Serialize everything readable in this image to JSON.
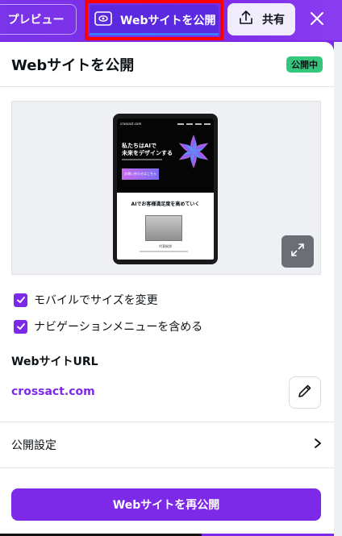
{
  "toolbar": {
    "preview_label": "プレビュー",
    "publish_label": "Webサイトを公開",
    "share_label": "共有"
  },
  "panel": {
    "title": "Webサイトを公開",
    "status_badge": "公開中"
  },
  "preview_site": {
    "logo": "crossact.com",
    "hero_title_line1": "私たちはAIで",
    "hero_title_line2": "未来をデザインする",
    "cta_label": "お問い合わせはこちら",
    "section_title": "AIでお客様満足度を高めていく",
    "person_caption": "代表挨拶"
  },
  "options": [
    {
      "label": "モバイルでサイズを変更",
      "checked": true
    },
    {
      "label": "ナビゲーションメニューを含める",
      "checked": true
    }
  ],
  "website_url": {
    "label": "WebサイトURL",
    "value": "crossact.com"
  },
  "settings": {
    "label": "公開設定"
  },
  "republish_label": "Webサイトを再公開",
  "colors": {
    "accent": "#7d2ae8",
    "status_green": "#34c77b",
    "highlight_red": "#ff0000"
  },
  "icons": [
    "publish-web-icon",
    "upload-share-icon",
    "close-icon",
    "expand-icon",
    "check-icon",
    "pencil-icon",
    "chevron-right-icon"
  ]
}
